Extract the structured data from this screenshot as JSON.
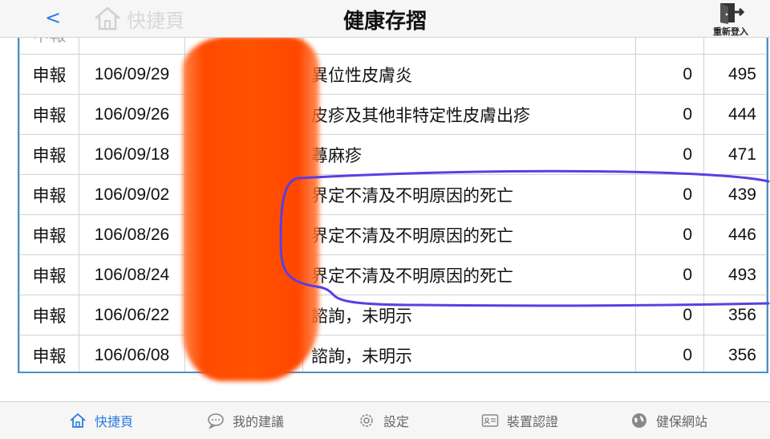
{
  "header": {
    "back_label": "<",
    "home_label": "快捷頁",
    "title": "健康存摺",
    "relogin_label": "重新登入"
  },
  "table": {
    "partial_row": {
      "type": "申報",
      "date": "",
      "diagnosis": "",
      "cost": "",
      "points": ""
    },
    "rows": [
      {
        "type": "申報",
        "date": "106/09/29",
        "diagnosis": "異位性皮膚炎",
        "cost": "0",
        "points": "495"
      },
      {
        "type": "申報",
        "date": "106/09/26",
        "diagnosis": "皮疹及其他非特定性皮膚出疹",
        "cost": "0",
        "points": "444"
      },
      {
        "type": "申報",
        "date": "106/09/18",
        "diagnosis": "蕁麻疹",
        "cost": "0",
        "points": "471"
      },
      {
        "type": "申報",
        "date": "106/09/02",
        "diagnosis": "界定不清及不明原因的死亡",
        "cost": "0",
        "points": "439"
      },
      {
        "type": "申報",
        "date": "106/08/26",
        "diagnosis": "界定不清及不明原因的死亡",
        "cost": "0",
        "points": "446"
      },
      {
        "type": "申報",
        "date": "106/08/24",
        "diagnosis": "界定不清及不明原因的死亡",
        "cost": "0",
        "points": "493"
      },
      {
        "type": "申報",
        "date": "106/06/22",
        "diagnosis": "諮詢，未明示",
        "cost": "0",
        "points": "356"
      },
      {
        "type": "申報",
        "date": "106/06/08",
        "diagnosis": "諮詢，未明示",
        "cost": "0",
        "points": "356"
      }
    ]
  },
  "bottom_nav": {
    "items": [
      {
        "label": "快捷頁",
        "icon": "home-icon"
      },
      {
        "label": "我的建議",
        "icon": "chat-bubble-icon"
      },
      {
        "label": "設定",
        "icon": "gear-icon"
      },
      {
        "label": "裝置認證",
        "icon": "id-card-icon"
      },
      {
        "label": "健保網站",
        "icon": "globe-icon"
      }
    ]
  },
  "colors": {
    "accent": "#2a7de1",
    "table_border": "#4a90c8",
    "redaction": "#ff4a00",
    "annotation": "#5b3fe0"
  }
}
